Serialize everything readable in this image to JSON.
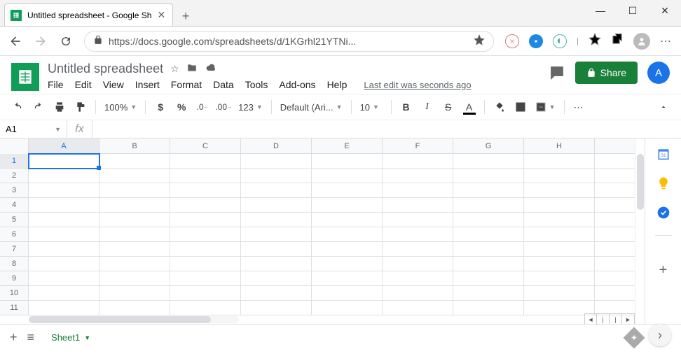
{
  "browser": {
    "tab_title": "Untitled spreadsheet - Google Sh",
    "url": "https://docs.google.com/spreadsheets/d/1KGrhl21YTNi..."
  },
  "app": {
    "title": "Untitled spreadsheet",
    "menus": [
      "File",
      "Edit",
      "View",
      "Insert",
      "Format",
      "Data",
      "Tools",
      "Add-ons",
      "Help"
    ],
    "last_edit": "Last edit was seconds ago",
    "share_label": "Share",
    "account_initial": "A"
  },
  "toolbar": {
    "zoom": "100%",
    "numfmt": "123",
    "font": "Default (Ari...",
    "font_size": "10"
  },
  "name_box": "A1",
  "columns": [
    "A",
    "B",
    "C",
    "D",
    "E",
    "F",
    "G",
    "H"
  ],
  "rows": [
    "1",
    "2",
    "3",
    "4",
    "5",
    "6",
    "7",
    "8",
    "9",
    "10",
    "11"
  ],
  "selected_cell": {
    "row": 0,
    "col": 0
  },
  "sheet_tabs": {
    "active": "Sheet1"
  }
}
